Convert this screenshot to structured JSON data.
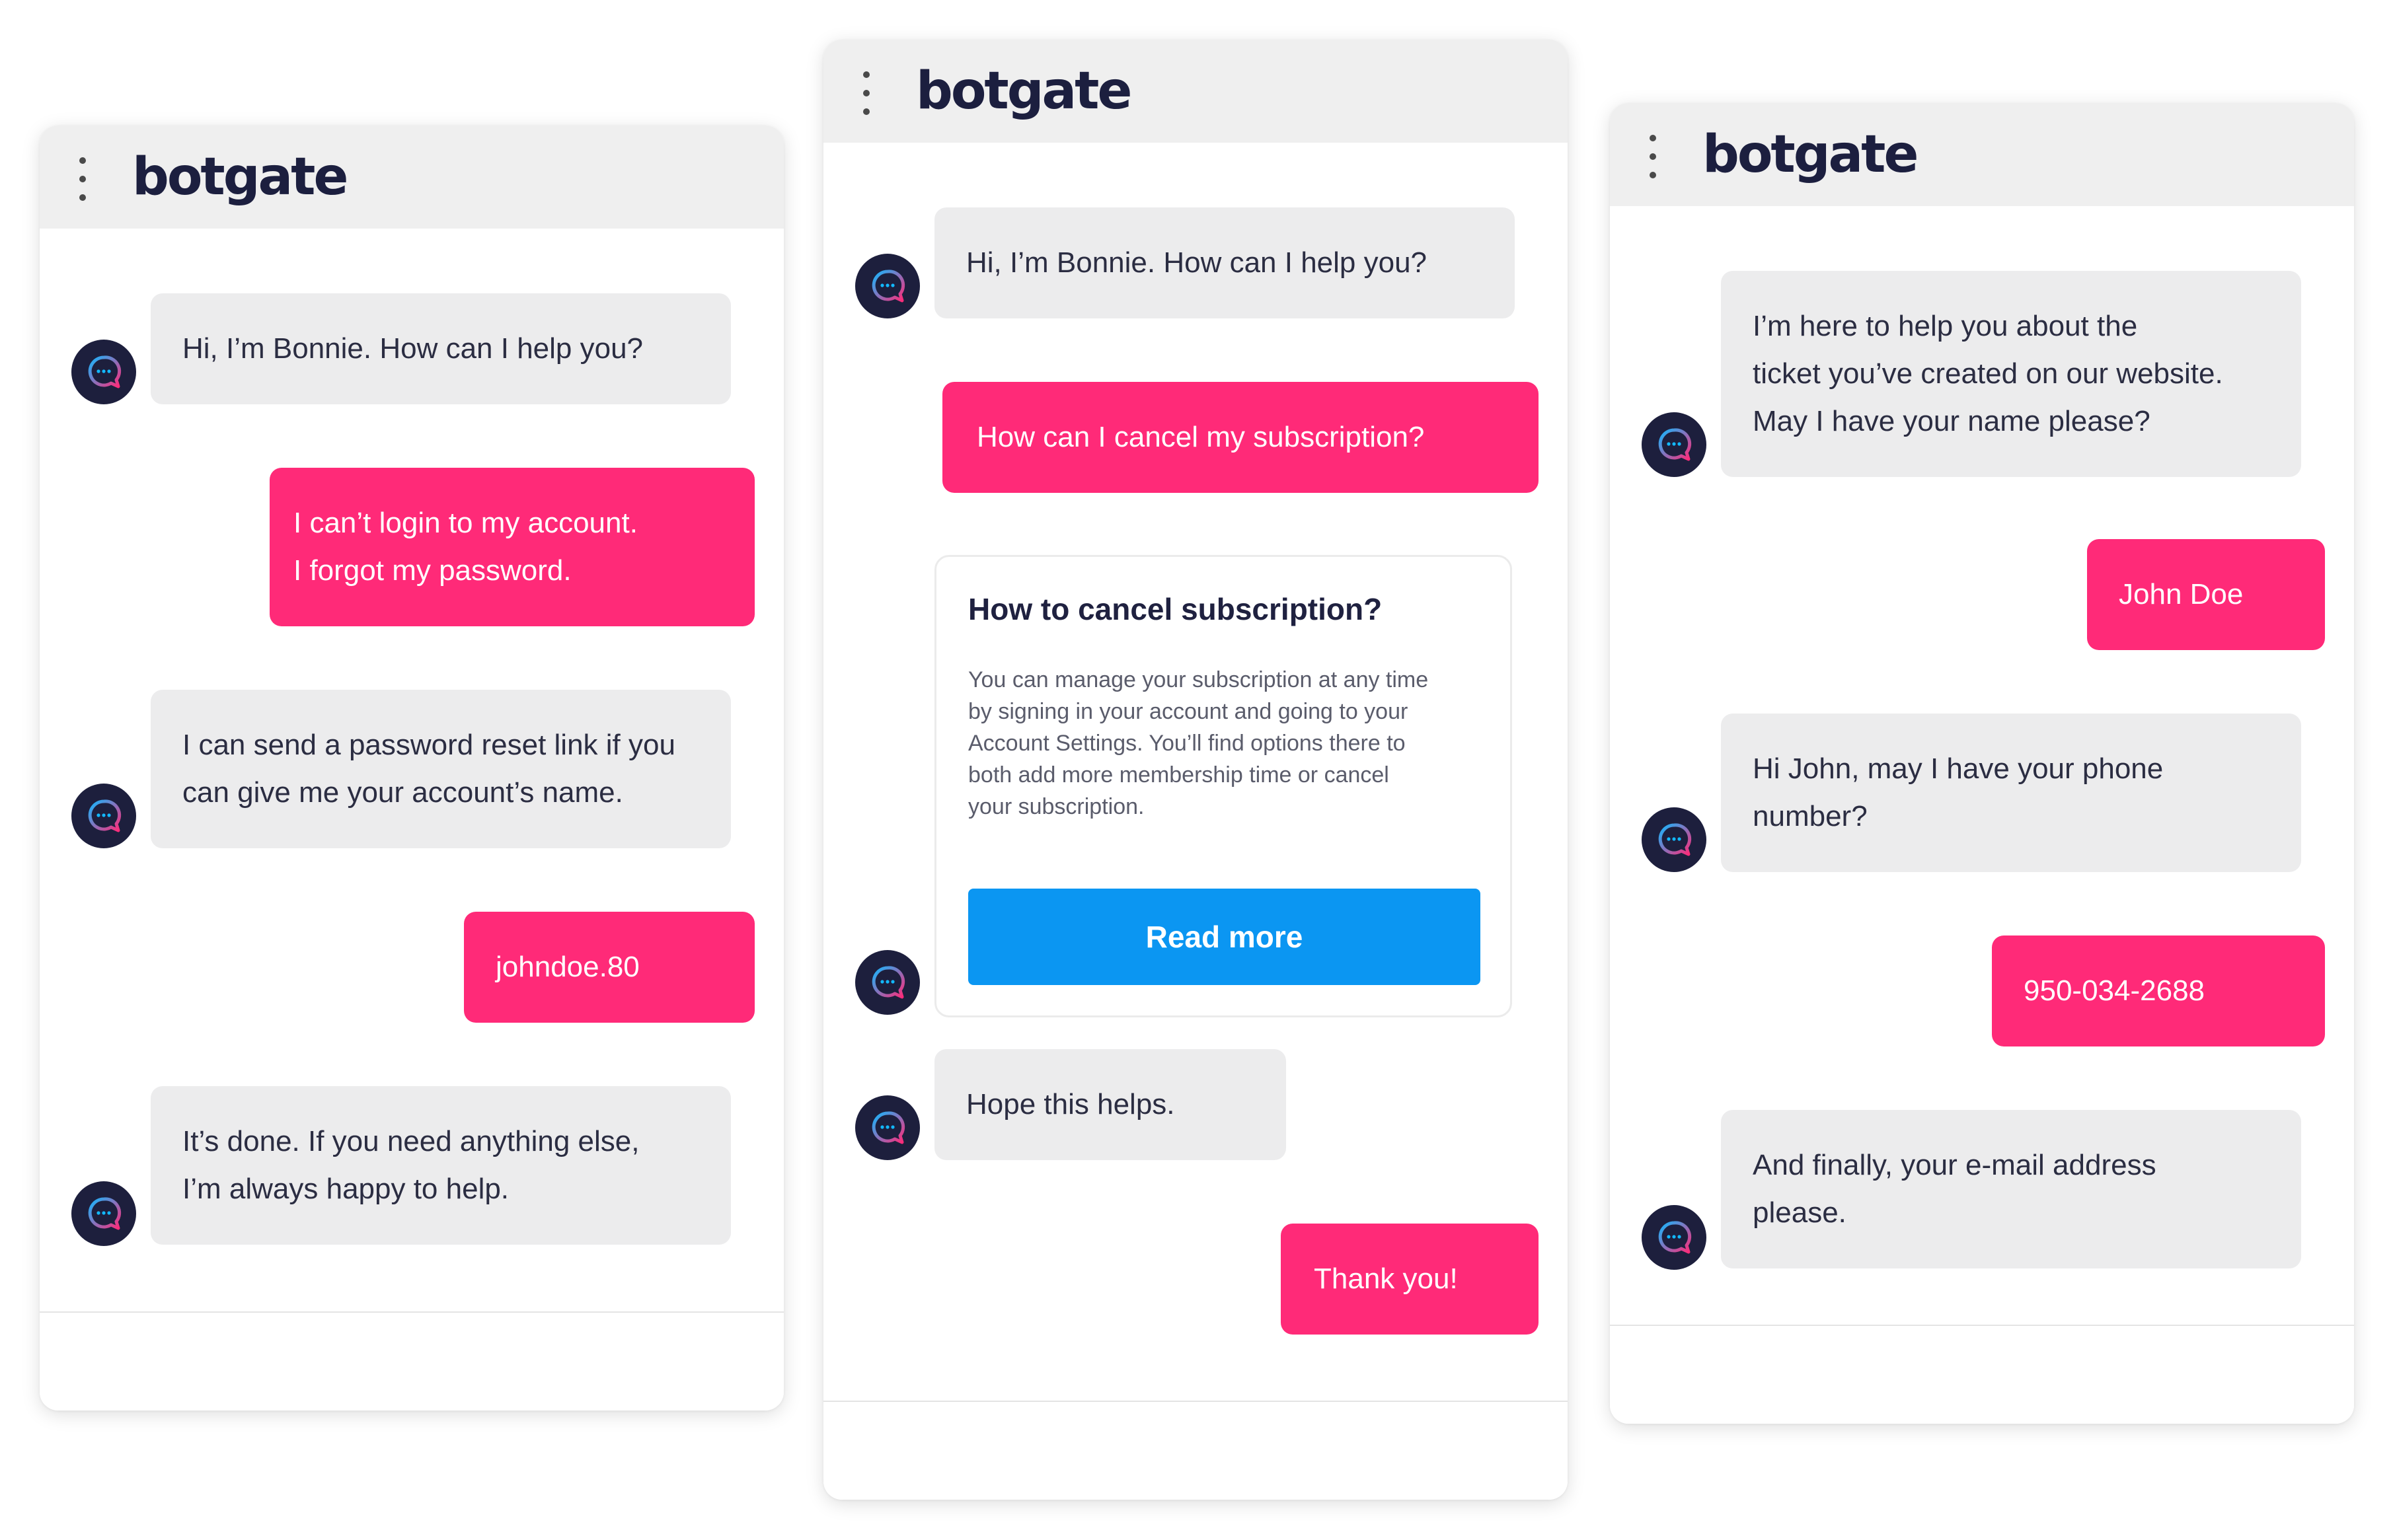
{
  "brand": {
    "logo_text": "botgate",
    "dark": "#1d1f3d",
    "accent_pink": "#ff2a78",
    "accent_blue": "#0b96f2",
    "bot_bubble_bg": "#ececed",
    "header_bg": "#efefef"
  },
  "icons": {
    "menu": "vertical-ellipsis-icon",
    "avatar": "chat-bubble-icon"
  },
  "windows": [
    {
      "messages": [
        {
          "from": "bot",
          "lines": [
            "Hi, I’m Bonnie. How can I help you?"
          ]
        },
        {
          "from": "user",
          "lines": [
            "I can’t login to my account.",
            "I forgot my password."
          ]
        },
        {
          "from": "bot",
          "lines": [
            "I can send a password reset link if you",
            "can give me your account’s name."
          ]
        },
        {
          "from": "user",
          "lines": [
            "johndoe.80"
          ]
        },
        {
          "from": "bot",
          "lines": [
            "It’s done. If you need anything else,",
            "I’m always happy to help."
          ]
        }
      ]
    },
    {
      "messages": [
        {
          "from": "bot",
          "lines": [
            "Hi, I’m Bonnie. How can I help you?"
          ]
        },
        {
          "from": "user",
          "lines": [
            "How can I cancel my subscription?"
          ]
        },
        {
          "from": "bot",
          "lines": [
            "Hope this helps."
          ]
        },
        {
          "from": "user",
          "lines": [
            "Thank you!"
          ]
        }
      ],
      "card": {
        "title": "How to cancel subscription?",
        "body_lines": [
          "You can manage your subscription at any time",
          "by signing in your account and going to your",
          "Account Settings. You’ll find options there to",
          "both add more membership time or cancel",
          "your subscription."
        ],
        "button_label": "Read more"
      }
    },
    {
      "messages": [
        {
          "from": "bot",
          "lines": [
            "I’m here to help you about the",
            "ticket you’ve created on our website.",
            "May I have your name please?"
          ]
        },
        {
          "from": "user",
          "lines": [
            "John Doe"
          ]
        },
        {
          "from": "bot",
          "lines": [
            "Hi John, may I have your phone",
            "number?"
          ]
        },
        {
          "from": "user",
          "lines": [
            "950-034-2688"
          ]
        },
        {
          "from": "bot",
          "lines": [
            "And finally, your e-mail address",
            "please."
          ]
        }
      ]
    }
  ]
}
